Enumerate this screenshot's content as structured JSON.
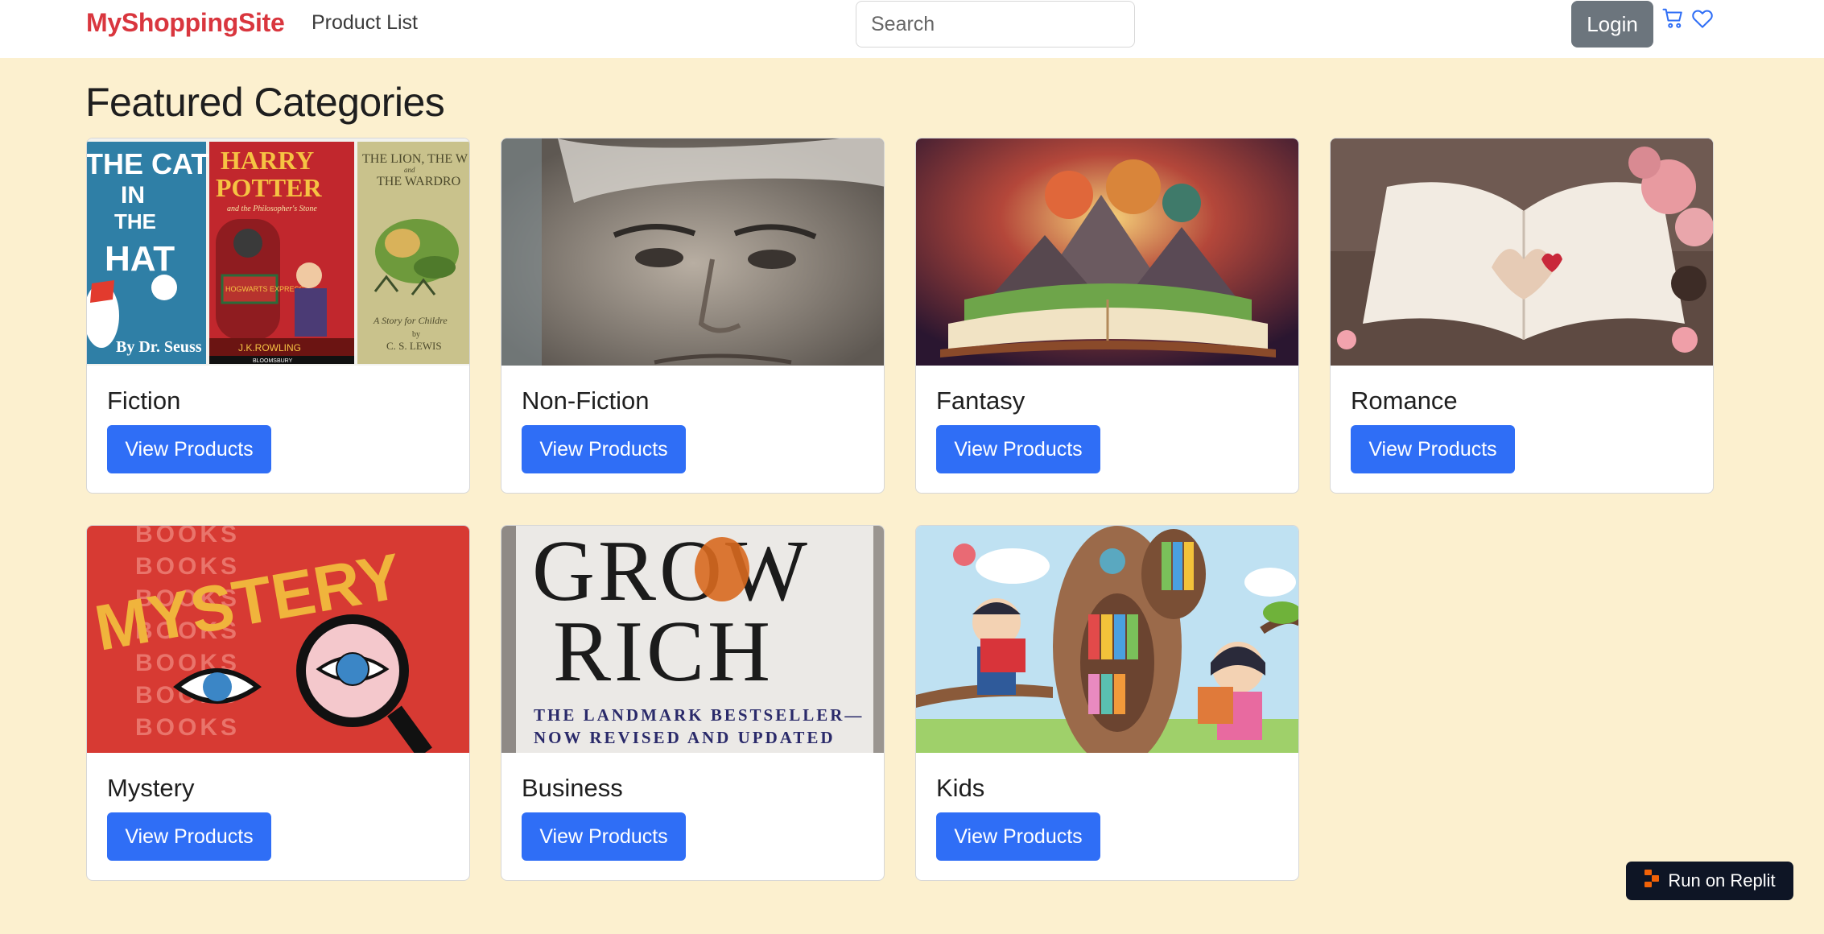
{
  "header": {
    "brand": "MyShoppingSite",
    "nav_link": "Product List",
    "search_placeholder": "Search",
    "login_label": "Login"
  },
  "main": {
    "title": "Featured Categories",
    "categories": [
      {
        "name": "Fiction",
        "button": "View Products"
      },
      {
        "name": "Non-Fiction",
        "button": "View Products"
      },
      {
        "name": "Fantasy",
        "button": "View Products"
      },
      {
        "name": "Romance",
        "button": "View Products"
      },
      {
        "name": "Mystery",
        "button": "View Products"
      },
      {
        "name": "Business",
        "button": "View Products"
      },
      {
        "name": "Kids",
        "button": "View Products"
      }
    ]
  },
  "images": {
    "fiction": {
      "cat_lines": [
        "THE CAT",
        "IN",
        "THE",
        "HAT"
      ],
      "cat_author": "By Dr. Seuss",
      "hp_lines": [
        "HARRY",
        "POTTER"
      ],
      "hp_sub": "and the Philosopher's Stone",
      "hp_train": "HOGWARTS EXPRESS",
      "hp_author": "J.K.ROWLING",
      "hp_pub": "BLOOMSBURY",
      "lion_lines": [
        "THE LION, THE W",
        "THE WARDRO"
      ],
      "lion_and": "and",
      "lion_tag": "A Story for Childre",
      "lion_by": "by",
      "lion_author": "C. S. LEWIS"
    },
    "mystery": {
      "bg_word": "BOOKS",
      "title": "MYSTERY"
    },
    "business": {
      "line1": "GROW",
      "line2": "RICH",
      "tag1": "THE LANDMARK BESTSELLER—",
      "tag2": "NOW REVISED AND UPDATED"
    }
  },
  "replit": {
    "label": "Run on Replit"
  },
  "colors": {
    "brand": "#d9363e",
    "primary": "#2f6ef6",
    "secondary": "#6c757d",
    "page_bg": "#fcf0cf",
    "replit_bg": "#0e1525",
    "replit_accent": "#f26207"
  },
  "icons": [
    "cart-icon",
    "heart-icon",
    "replit-logo-icon"
  ]
}
